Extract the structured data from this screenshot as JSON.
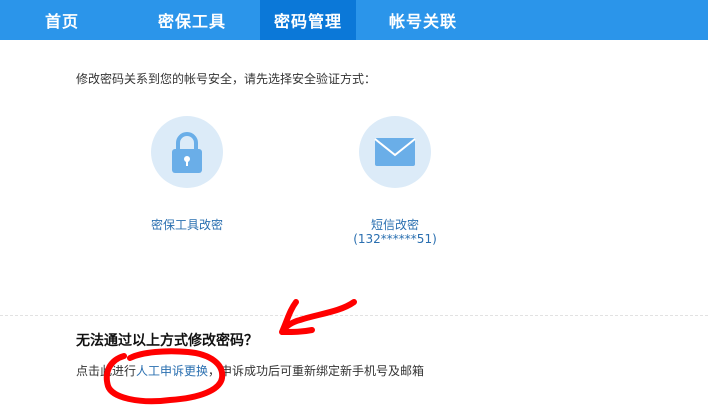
{
  "nav": {
    "tabs": [
      {
        "label": "首页"
      },
      {
        "label": "密保工具"
      },
      {
        "label": "密码管理",
        "active": true
      },
      {
        "label": "帐号关联"
      }
    ],
    "bg_color": "#2b95ea",
    "active_color": "#0b78d8"
  },
  "main": {
    "instruction": "修改密码关系到您的帐号安全，请先选择安全验证方式：",
    "options": [
      {
        "label": "密保工具改密",
        "icon": "lock-icon"
      },
      {
        "label": "短信改密",
        "sub": "(132******51)",
        "icon": "envelope-icon"
      }
    ]
  },
  "footer": {
    "heading": "无法通过以上方式修改密码？",
    "prefix": "点击此进行",
    "link": "人工申诉更换",
    "suffix": "，申诉成功后可重新绑定新手机号及邮箱"
  },
  "annotation": {
    "color": "#ff0000",
    "shapes": [
      "arrow",
      "circle"
    ]
  }
}
